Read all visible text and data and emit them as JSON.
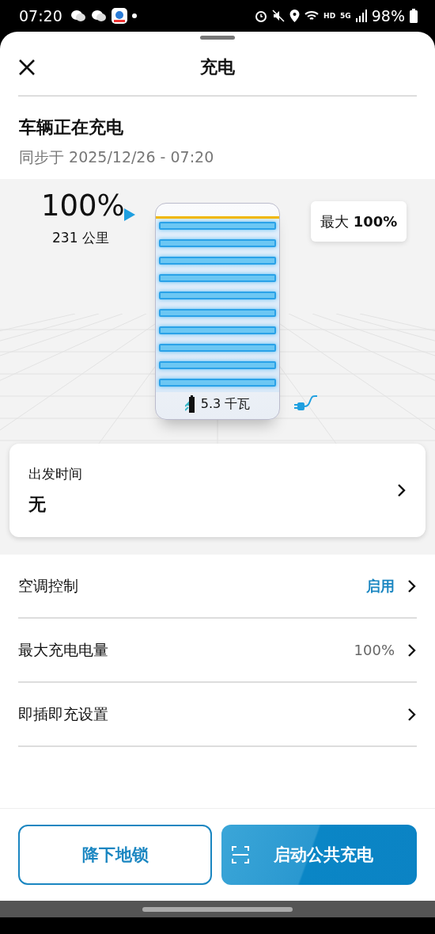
{
  "status_bar": {
    "time": "07:20",
    "hd": "HD",
    "network": "5G",
    "battery": "98%"
  },
  "header": {
    "title": "充电"
  },
  "status": {
    "title": "车辆正在充电",
    "synced": "同步于 2025/12/26 - 07:20"
  },
  "battery": {
    "percent": "100%",
    "range": "231 公里",
    "level": 1,
    "max_label": "最大 **100%**",
    "power": "5.3 千瓦"
  },
  "departure": {
    "label": "出发时间",
    "value": "无"
  },
  "settings": [
    {
      "label": "空调控制",
      "value": "启用",
      "kind": "link"
    },
    {
      "label": "最大充电电量",
      "value": "100%",
      "kind": "plain"
    },
    {
      "label": "即插即充设置",
      "kind": "plain"
    }
  ],
  "buttons": [
    {
      "label": "降下地锁",
      "kind": "outline"
    },
    {
      "label": "启动公共充电",
      "kind": "primary"
    }
  ]
}
